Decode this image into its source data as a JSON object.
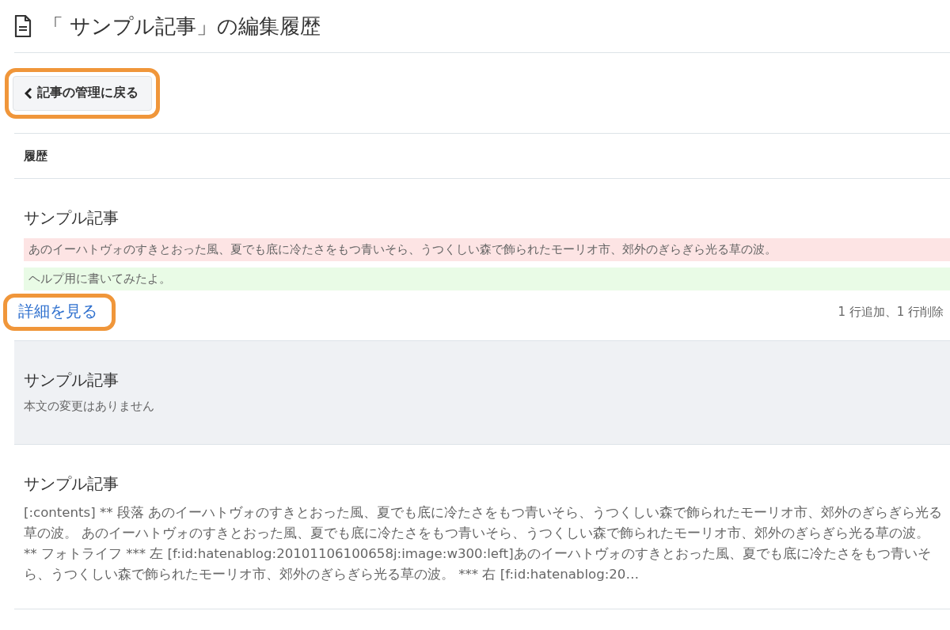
{
  "page_title": "「 サンプル記事」の編集履歴",
  "back_button": {
    "label": "記事の管理に戻る",
    "callout": true
  },
  "section_heading": "履歴",
  "entries": [
    {
      "kind": "diff",
      "title": "サンプル記事",
      "highlighted": false,
      "deleted": [
        "あのイーハトヴォのすきとおった風、夏でも底に冷たさをもつ青いそら、うつくしい森で飾られたモーリオ市、郊外のぎらぎら光る草の波。"
      ],
      "added": [
        "ヘルプ用に書いてみたよ。"
      ],
      "link": {
        "label": "詳細を見る",
        "callout": true
      },
      "summary": "1 行追加、1 行削除"
    },
    {
      "kind": "note",
      "title": "サンプル記事",
      "highlighted": true,
      "note": "本文の変更はありません"
    },
    {
      "kind": "text",
      "title": "サンプル記事",
      "highlighted": false,
      "body": "[:contents] ** 段落 あのイーハトヴォのすきとおった風、夏でも底に冷たさをもつ青いそら、うつくしい森で飾られたモーリオ市、郊外のぎらぎら光る草の波。 あのイーハトヴォのすきとおった風、夏でも底に冷たさをもつ青いそら、うつくしい森で飾られたモーリオ市、郊外のぎらぎら光る草の波。 ** フォトライフ *** 左 [f:id:hatenablog:20101106100658j:image:w300:left]あのイーハトヴォのすきとおった風、夏でも底に冷たさをもつ青いそら、うつくしい森で飾られたモーリオ市、郊外のぎらぎら光る草の波。 *** 右 [f:id:hatenablog:20…"
    }
  ]
}
